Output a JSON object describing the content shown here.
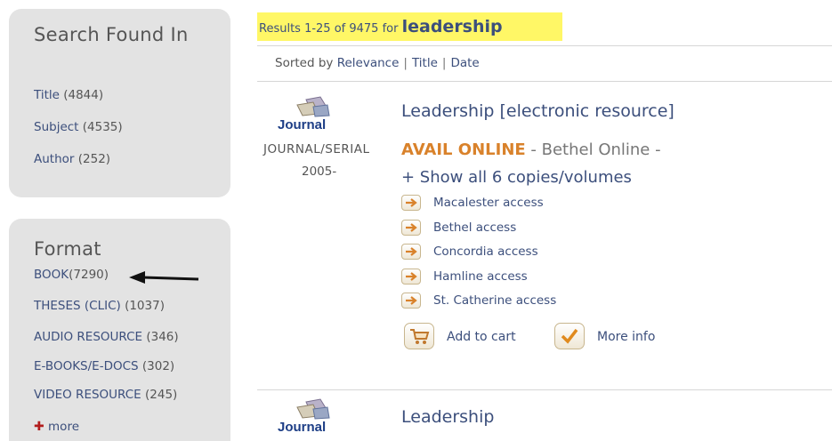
{
  "sidebar": {
    "search_found_in": {
      "title": "Search Found In",
      "items": [
        {
          "label": "Title",
          "count": "(4844)"
        },
        {
          "label": "Subject",
          "count": "(4535)"
        },
        {
          "label": "Author",
          "count": "(252)"
        }
      ]
    },
    "format": {
      "title": "Format",
      "items": [
        {
          "label": "BOOK",
          "count": "(7290)"
        },
        {
          "label": "THESES (CLIC)",
          "count": "(1037)"
        },
        {
          "label": "AUDIO RESOURCE",
          "count": "(346)"
        },
        {
          "label": "E-BOOKS/E-DOCS",
          "count": "(302)"
        },
        {
          "label": "VIDEO RESOURCE",
          "count": "(245)"
        }
      ],
      "more_label": "more"
    }
  },
  "results": {
    "summary_prefix": "Results 1-25 of 9475 for",
    "query": "leadership",
    "sort": {
      "label": "Sorted by",
      "options": [
        "Relevance",
        "Title",
        "Date"
      ]
    }
  },
  "records": [
    {
      "thumbnail_label": "Journal",
      "title": "Leadership [electronic resource]",
      "format": "JOURNAL/SERIAL",
      "date": "2005-",
      "availability_status": "AVAIL ONLINE",
      "availability_location": "-  Bethel Online  -",
      "show_copies": "+ Show all 6 copies/volumes",
      "access_links": [
        "Macalester access",
        "Bethel access",
        "Concordia access",
        "Hamline access",
        "St. Catherine access"
      ],
      "add_to_cart": "Add to cart",
      "more_info": "More info"
    },
    {
      "thumbnail_label": "Journal",
      "title": "Leadership"
    }
  ],
  "colors": {
    "panel_bg": "#e3e3e3",
    "link": "#3c4f7c",
    "highlight": "#fff766",
    "avail_online": "#d9822b",
    "more_plus": "#b21d1d"
  },
  "icons": [
    "arrow-right-icon",
    "cart-icon",
    "checkmark-icon",
    "plus-icon",
    "journal-icon"
  ]
}
